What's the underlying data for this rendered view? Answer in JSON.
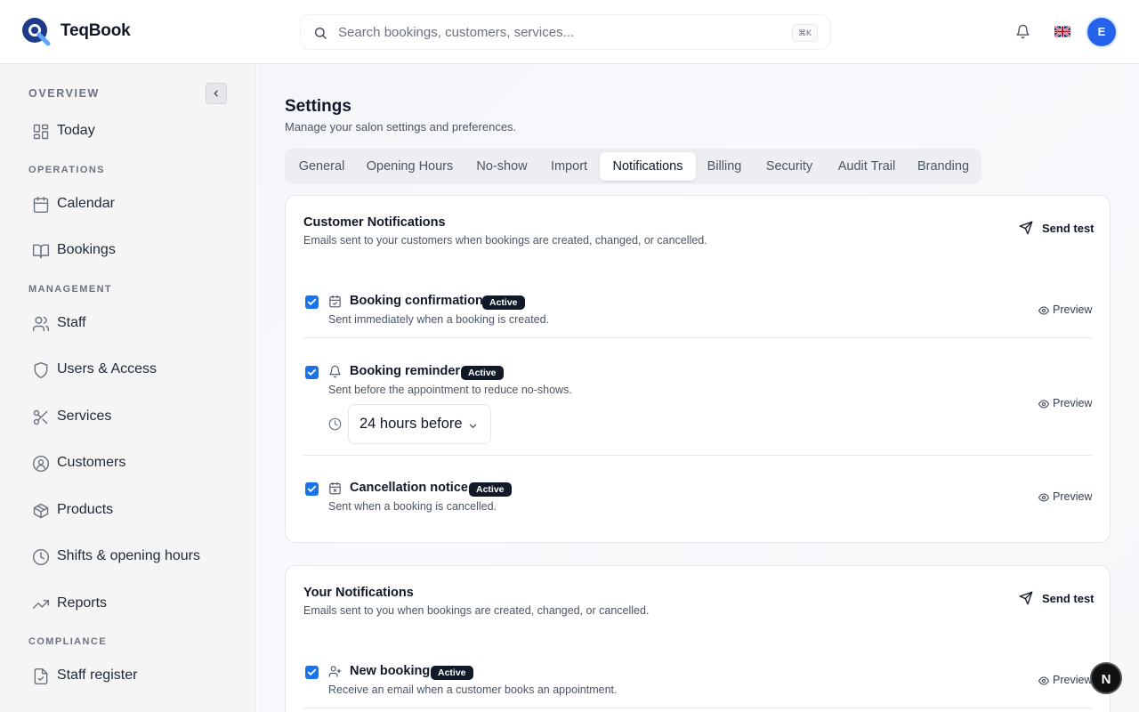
{
  "app": {
    "brand": "TeqBook",
    "search_placeholder": "Search bookings, customers, services...",
    "search_shortcut": "⌘K",
    "user_initial": "E",
    "fab_label": "N"
  },
  "sidebar": {
    "sections": {
      "overview": "OVERVIEW",
      "operations": "OPERATIONS",
      "management": "MANAGEMENT",
      "compliance": "COMPLIANCE"
    },
    "items": [
      {
        "label": "Today",
        "icon": "dashboard-icon"
      },
      {
        "label": "Calendar",
        "icon": "calendar-icon"
      },
      {
        "label": "Bookings",
        "icon": "book-open-icon"
      },
      {
        "label": "Staff",
        "icon": "users-icon"
      },
      {
        "label": "Users & Access",
        "icon": "shield-icon"
      },
      {
        "label": "Services",
        "icon": "scissors-icon"
      },
      {
        "label": "Customers",
        "icon": "user-circle-icon"
      },
      {
        "label": "Products",
        "icon": "package-icon"
      },
      {
        "label": "Shifts & opening hours",
        "icon": "clock-icon"
      },
      {
        "label": "Reports",
        "icon": "trending-up-icon"
      },
      {
        "label": "Staff register",
        "icon": "file-check-icon"
      }
    ]
  },
  "page": {
    "title": "Settings",
    "subtitle": "Manage your salon settings and preferences.",
    "tabs": [
      "General",
      "Opening Hours",
      "No-show",
      "Import",
      "Notifications",
      "Billing",
      "Security",
      "Audit Trail",
      "Branding"
    ],
    "active_tab": "Notifications"
  },
  "customer_notifications": {
    "title": "Customer Notifications",
    "subtitle": "Emails sent to your customers when bookings are created, changed, or cancelled.",
    "send_test": "Send test",
    "items": [
      {
        "title": "Booking confirmation",
        "badge": "Active",
        "desc": "Sent immediately when a booking is created.",
        "preview": "Preview",
        "checked": true
      },
      {
        "title": "Booking reminder",
        "badge": "Active",
        "desc": "Sent before the appointment to reduce no-shows.",
        "preview": "Preview",
        "checked": true,
        "timing": "24 hours before"
      },
      {
        "title": "Cancellation notice",
        "badge": "Active",
        "desc": "Sent when a booking is cancelled.",
        "preview": "Preview",
        "checked": true
      }
    ]
  },
  "your_notifications": {
    "title": "Your Notifications",
    "subtitle": "Emails sent to you when bookings are created, changed, or cancelled.",
    "send_test": "Send test",
    "items": [
      {
        "title": "New booking",
        "badge": "Active",
        "desc": "Receive an email when a customer books an appointment.",
        "preview": "Preview",
        "checked": true
      }
    ]
  },
  "colors": {
    "accent": "#2563eb",
    "checkbox": "#1a73e8",
    "badge_bg": "#111827"
  }
}
